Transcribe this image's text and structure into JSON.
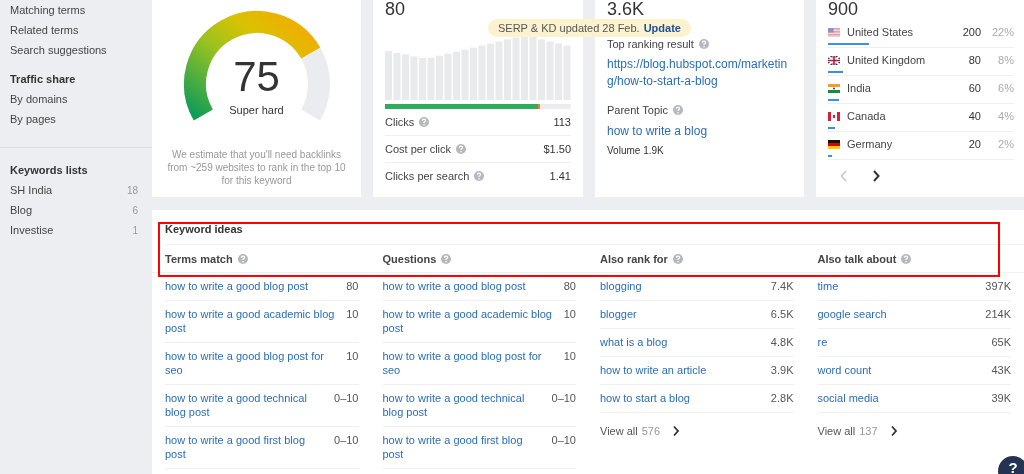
{
  "sidebar": {
    "groups": [
      {
        "items": [
          {
            "label": "Matching terms"
          },
          {
            "label": "Related terms"
          },
          {
            "label": "Search suggestions"
          }
        ]
      },
      {
        "title": "Traffic share",
        "items": [
          {
            "label": "By domains"
          },
          {
            "label": "By pages"
          }
        ]
      }
    ],
    "lists": {
      "title": "Keywords lists",
      "items": [
        {
          "label": "SH India",
          "count": "18"
        },
        {
          "label": "Blog",
          "count": "6"
        },
        {
          "label": "Investise",
          "count": "1"
        }
      ]
    }
  },
  "difficulty": {
    "score": "75",
    "label": "Super hard",
    "note": "We estimate that you'll need backlinks from ~259 websites to rank in the top 10 for this keyword"
  },
  "clicks_card": {
    "value": "80",
    "clicks_bar": [
      {
        "kind": "organic",
        "level": 0.82
      },
      {
        "kind": "paid",
        "level": 0.015
      }
    ],
    "metrics": [
      {
        "label": "Clicks",
        "value": "113"
      },
      {
        "label": "Cost per click",
        "value": "$1.50"
      },
      {
        "label": "Clicks per search",
        "value": "1.41"
      }
    ]
  },
  "notice": {
    "text": "SERP & KD updated 28 Feb.",
    "action": "Update"
  },
  "ranking_card": {
    "value": "3.6K",
    "top_label": "Top ranking result",
    "url": "https://blog.hubspot.com/marketing/how-to-start-a-blog",
    "parent_label": "Parent Topic",
    "parent_topic": "how to write a blog",
    "volume": "Volume 1.9K"
  },
  "countries_card": {
    "value": "900",
    "countries": [
      {
        "name": "United States",
        "kind": "us",
        "volume": "200",
        "share": "22%",
        "level": 0.22
      },
      {
        "name": "United Kingdom",
        "kind": "gb",
        "volume": "80",
        "share": "8%",
        "level": 0.08
      },
      {
        "name": "India",
        "kind": "in",
        "volume": "60",
        "share": "6%",
        "level": 0.06
      },
      {
        "name": "Canada",
        "kind": "ca",
        "volume": "40",
        "share": "4%",
        "level": 0.04
      },
      {
        "name": "Germany",
        "kind": "de",
        "volume": "20",
        "share": "2%",
        "level": 0.02
      }
    ]
  },
  "keyword_ideas": {
    "title": "Keyword ideas",
    "columns": [
      {
        "title": "Terms match",
        "rows": [
          {
            "keyword": "how to write a good blog post",
            "value": "80"
          },
          {
            "keyword": "how to write a good academic blog post",
            "value": "10"
          },
          {
            "keyword": "how to write a good blog post for seo",
            "value": "10"
          },
          {
            "keyword": "how to write a good technical blog post",
            "value": "0–10"
          },
          {
            "keyword": "how to write a good first blog post",
            "value": "0–10"
          }
        ]
      },
      {
        "title": "Questions",
        "rows": [
          {
            "keyword": "how to write a good blog post",
            "value": "80"
          },
          {
            "keyword": "how to write a good academic blog post",
            "value": "10"
          },
          {
            "keyword": "how to write a good blog post for seo",
            "value": "10"
          },
          {
            "keyword": "how to write a good technical blog post",
            "value": "0–10"
          },
          {
            "keyword": "how to write a good first blog post",
            "value": "0–10"
          }
        ]
      },
      {
        "title": "Also rank for",
        "rows": [
          {
            "keyword": "blogging",
            "value": "7.4K"
          },
          {
            "keyword": "blogger",
            "value": "6.5K"
          },
          {
            "keyword": "what is a blog",
            "value": "4.8K"
          },
          {
            "keyword": "how to write an article",
            "value": "3.9K"
          },
          {
            "keyword": "how to start a blog",
            "value": "2.8K"
          }
        ],
        "view_all": {
          "label": "View all",
          "count": "576"
        }
      },
      {
        "title": "Also talk about",
        "rows": [
          {
            "keyword": "time",
            "value": "397K"
          },
          {
            "keyword": "google search",
            "value": "214K"
          },
          {
            "keyword": "re",
            "value": "65K"
          },
          {
            "keyword": "word count",
            "value": "43K"
          },
          {
            "keyword": "social media",
            "value": "39K"
          }
        ],
        "view_all": {
          "label": "View all",
          "count": "137"
        }
      }
    ]
  },
  "help_button": "?"
}
